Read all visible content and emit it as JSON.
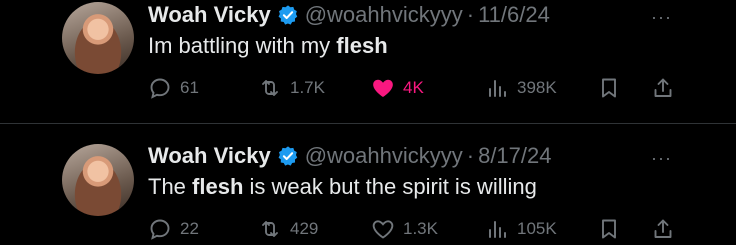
{
  "accent": {
    "like": "#f91880",
    "verified": "#1d9bf0"
  },
  "tweets": [
    {
      "name": "Woah Vicky",
      "handle": "@woahhvickyyy",
      "dot": "·",
      "date": "11/6/24",
      "more": "···",
      "text": {
        "pre": "Im battling with my ",
        "bold1": "flesh",
        "mid": "",
        "bold2": "",
        "post": ""
      },
      "replies": "61",
      "retweets": "1.7K",
      "likes": "4K",
      "liked": true,
      "views": "398K"
    },
    {
      "name": "Woah Vicky",
      "handle": "@woahhvickyyy",
      "dot": "·",
      "date": "8/17/24",
      "more": "···",
      "text": {
        "pre": "The ",
        "bold1": "flesh",
        "mid": " is weak but the spirit is willing",
        "bold2": "",
        "post": ""
      },
      "replies": "22",
      "retweets": "429",
      "likes": "1.3K",
      "liked": false,
      "views": "105K"
    }
  ]
}
